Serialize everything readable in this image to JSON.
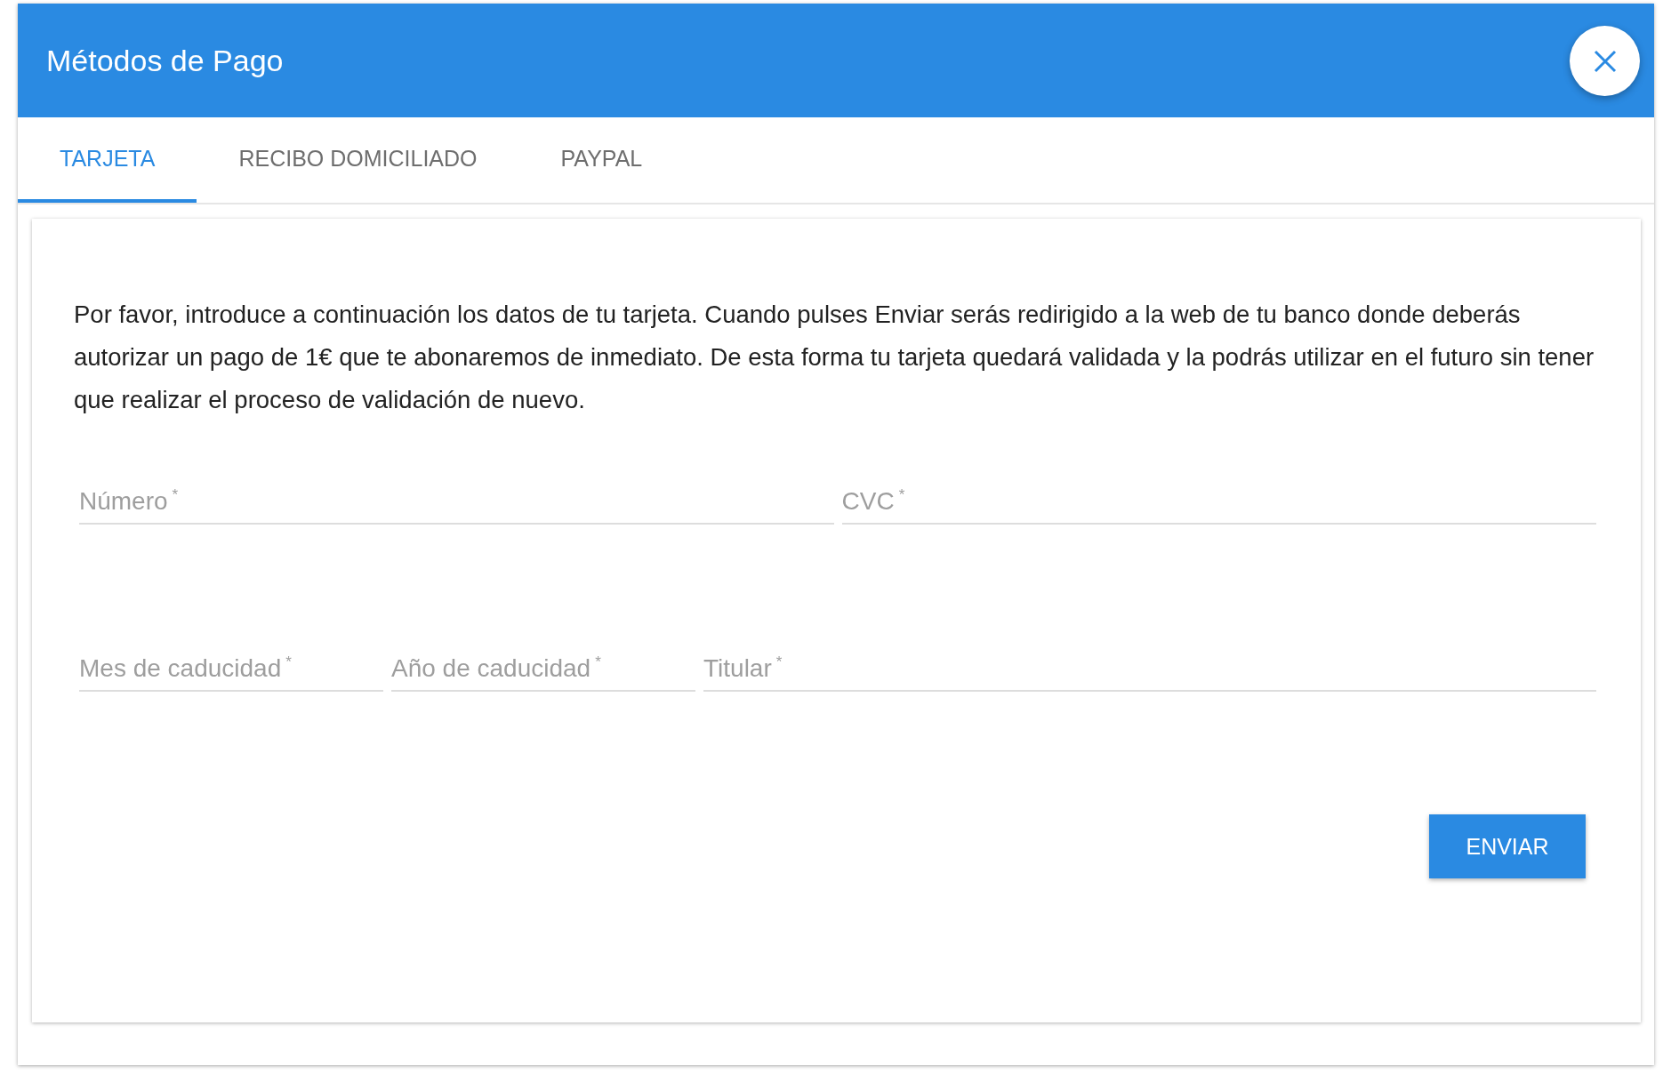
{
  "dialog": {
    "title": "Métodos de Pago"
  },
  "tabs": [
    {
      "label": "TARJETA",
      "selected": true
    },
    {
      "label": "RECIBO DOMICILIADO",
      "selected": false
    },
    {
      "label": "PAYPAL",
      "selected": false
    }
  ],
  "intro": "Por favor, introduce a continuación los datos de tu tarjeta. Cuando pulses Enviar serás redirigido a la web de tu banco donde deberás autorizar un pago de 1€ que te abonaremos de inmediato. De esta forma tu tarjeta quedará validada y la podrás utilizar en el futuro sin tener que realizar el proceso de validación de nuevo.",
  "field_rows": [
    [
      {
        "placeholder": "Número",
        "required": true
      },
      {
        "placeholder": "CVC",
        "required": true
      }
    ],
    [
      {
        "placeholder": "Mes de caducidad",
        "required": true
      },
      {
        "placeholder": "Año de caducidad",
        "required": true
      },
      {
        "placeholder": "Titular",
        "required": true
      }
    ]
  ],
  "required_mark": "*",
  "submit": {
    "label": "ENVIAR"
  }
}
